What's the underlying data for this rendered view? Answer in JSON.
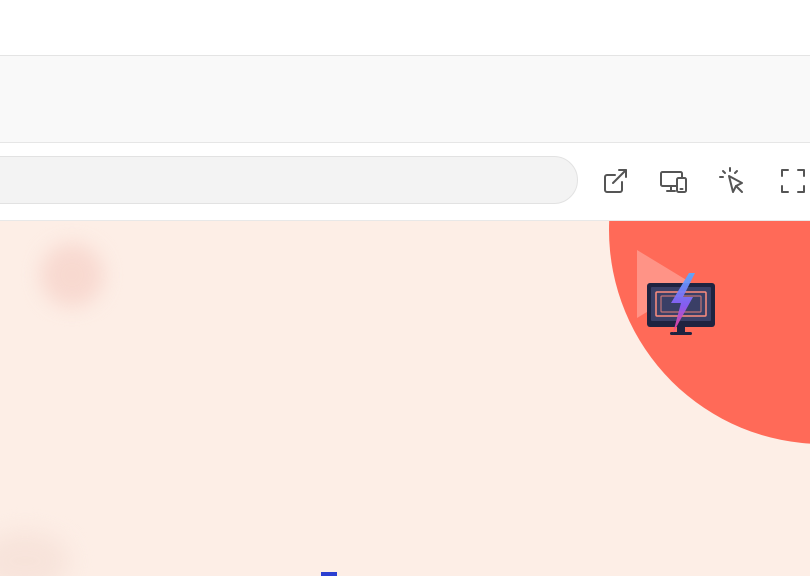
{
  "toolbar": {
    "address": {
      "value": "",
      "placeholder": ""
    },
    "icons": [
      "open-in-new-window-icon",
      "responsive-devices-icon",
      "click-cursor-icon",
      "fullscreen-icon"
    ]
  },
  "preview": {
    "background_color": "#fdeee6",
    "accent_color": "#ff6a58",
    "logo": "monitor-lightning-logo"
  }
}
